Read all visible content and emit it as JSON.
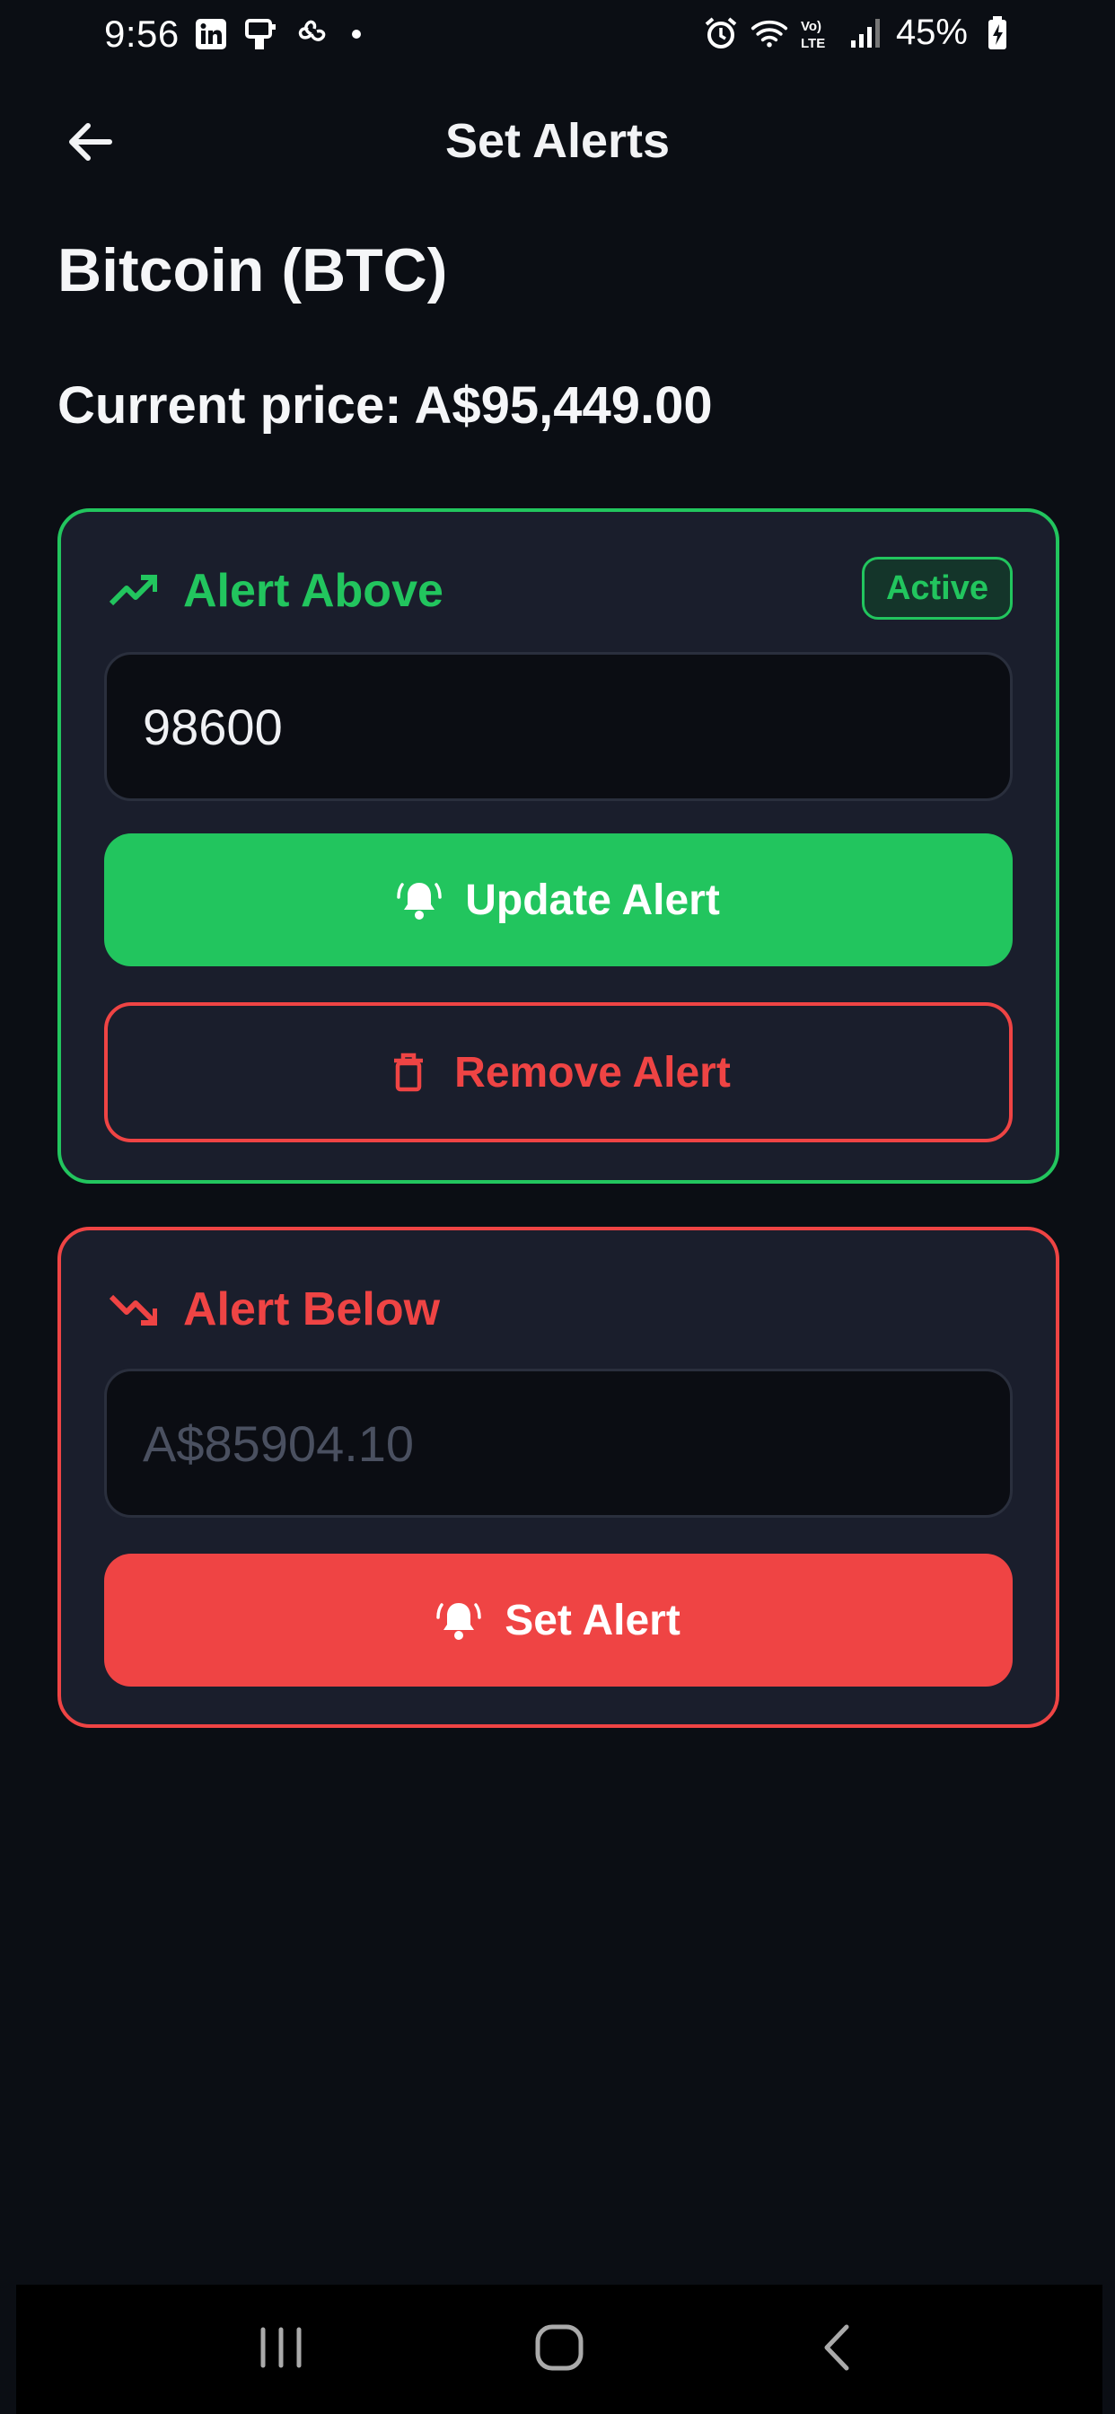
{
  "status_bar": {
    "time": "9:56",
    "battery": "45%",
    "left_icons": [
      "linkedin-icon",
      "app-icon",
      "fan-icon"
    ],
    "right_icons": [
      "alarm-icon",
      "wifi-icon",
      "volte-icon",
      "signal-icon",
      "battery-charging-icon"
    ]
  },
  "header": {
    "title": "Set Alerts",
    "back_icon": "arrow-left-icon"
  },
  "coin": {
    "name": "Bitcoin (BTC)",
    "current_price": "Current price: A$95,449.00"
  },
  "alert_above": {
    "label": "Alert Above",
    "icon": "trending-up-icon",
    "badge": "Active",
    "input_value": "98600",
    "update_button": "Update Alert",
    "remove_button": "Remove Alert",
    "accent": "#22c55e"
  },
  "alert_below": {
    "label": "Alert Below",
    "icon": "trending-down-icon",
    "input_placeholder": "A$85904.10",
    "set_button": "Set Alert",
    "accent": "#ef4444"
  },
  "nav": {
    "icons": [
      "recent-apps-icon",
      "home-icon",
      "back-icon"
    ]
  }
}
